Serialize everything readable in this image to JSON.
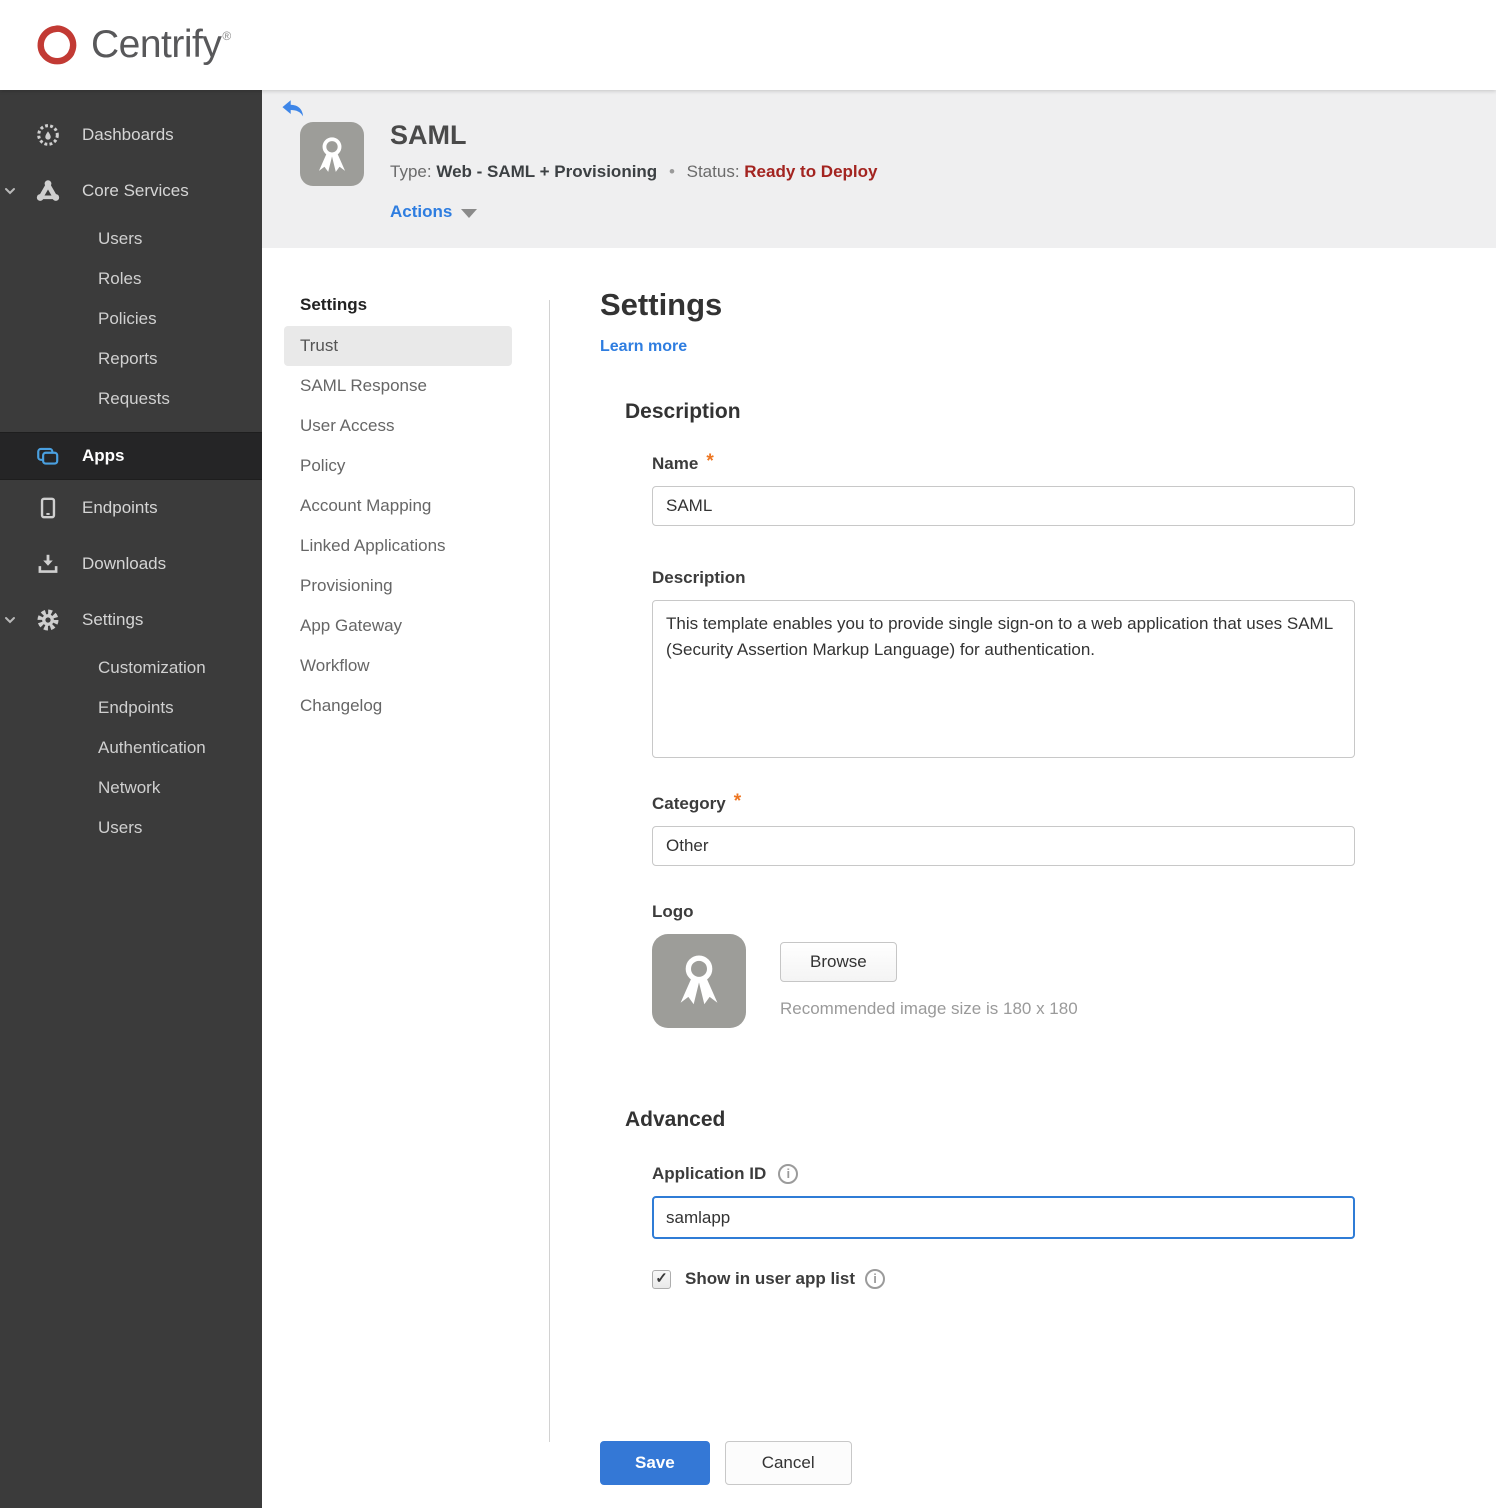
{
  "topbar": {
    "brand": "Centrify",
    "registered_mark": "®"
  },
  "sidebar": {
    "dashboards": "Dashboards",
    "core_services": "Core Services",
    "core_children": [
      "Users",
      "Roles",
      "Policies",
      "Reports",
      "Requests"
    ],
    "apps": "Apps",
    "endpoints": "Endpoints",
    "downloads": "Downloads",
    "settings": "Settings",
    "settings_children": [
      "Customization",
      "Endpoints",
      "Authentication",
      "Network",
      "Users"
    ],
    "icons": {
      "dashboards": "gauge-icon",
      "core_services": "core-services-icon",
      "apps": "apps-icon",
      "endpoints": "mobile-icon",
      "downloads": "download-icon",
      "settings": "gear-icon"
    }
  },
  "app_header": {
    "title": "SAML",
    "type_label": "Type:",
    "type_value": "Web - SAML + Provisioning",
    "separator": "•",
    "status_label": "Status:",
    "status_value": "Ready to Deploy",
    "actions_label": "Actions",
    "app_icon": "award-ribbon-icon",
    "back_icon": "back-arrow-icon"
  },
  "subnav": {
    "heading": "Settings",
    "active_item": "Trust",
    "items": [
      "Trust",
      "SAML Response",
      "User Access",
      "Policy",
      "Account Mapping",
      "Linked Applications",
      "Provisioning",
      "App Gateway",
      "Workflow",
      "Changelog"
    ]
  },
  "main": {
    "heading": "Settings",
    "learn_more": "Learn more",
    "description": {
      "heading": "Description",
      "name_label": "Name",
      "required_mark": "*",
      "name_value": "SAML",
      "description_label": "Description",
      "description_value": "This template enables you to provide single sign-on to a web application that uses SAML (Security Assertion Markup Language) for authentication.",
      "category_label": "Category",
      "category_value": "Other",
      "logo_label": "Logo",
      "browse_label": "Browse",
      "logo_hint": "Recommended image size is 180 x 180",
      "logo_icon": "award-ribbon-icon"
    },
    "advanced": {
      "heading": "Advanced",
      "app_id_label": "Application ID",
      "app_id_value": "samlapp",
      "info_glyph": "i",
      "checkbox_checked": true,
      "checkbox_glyph": "✓",
      "show_label": "Show in user app list"
    },
    "save_label": "Save",
    "cancel_label": "Cancel"
  },
  "colors": {
    "accent_blue": "#2e7de0",
    "save_blue": "#3478d6",
    "brand_red": "#c23a34",
    "status_red": "#a32420",
    "required_orange": "#ed7622",
    "sidebar_bg": "#3b3b3b",
    "sidebar_active_bg": "#252526",
    "header_band": "#efeff0",
    "apps_icon_blue": "#4aa0e0"
  }
}
